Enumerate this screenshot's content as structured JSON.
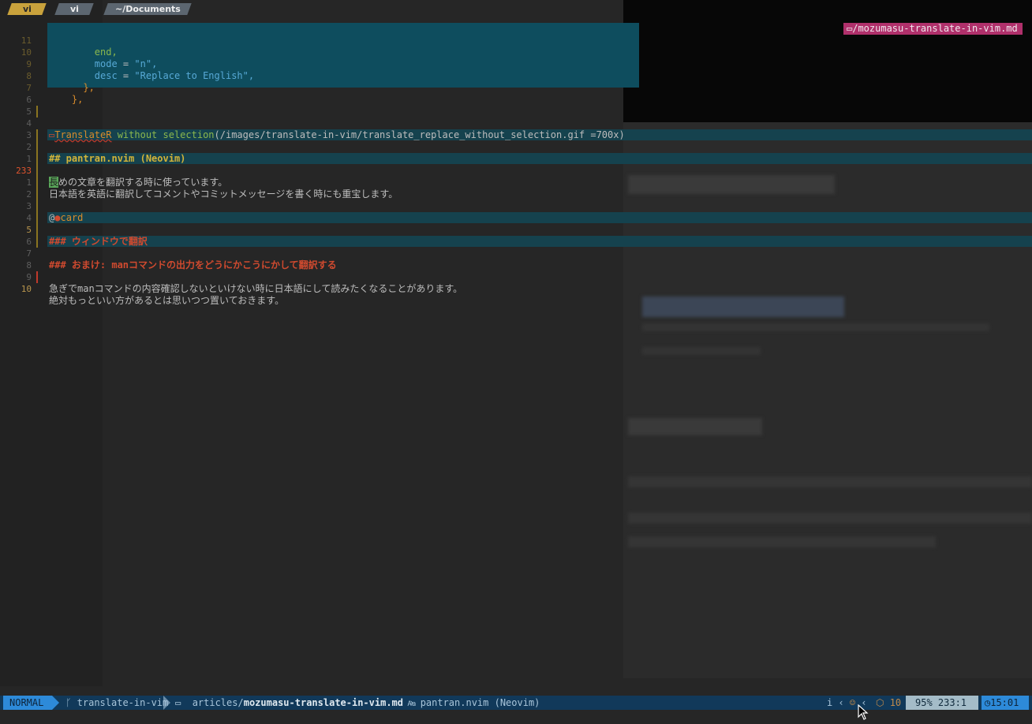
{
  "tabs": [
    {
      "label": "vi"
    },
    {
      "label": "vi"
    },
    {
      "label": "~/Documents"
    }
  ],
  "file_tag": "/mozumasu-translate-in-vim.md",
  "popup_lines": [
    {
      "num": "11",
      "text": "        end,"
    },
    {
      "num": "10",
      "key": "        mode",
      "eq": " = ",
      "val": "\"n\","
    },
    {
      "num": "9",
      "key": "        desc",
      "eq": " = ",
      "val": "\"Replace to English\","
    },
    {
      "num": "8",
      "text": "      },"
    },
    {
      "num": "7",
      "text": "    },"
    }
  ],
  "editor": {
    "l6_num": "6",
    "l5_num": "5",
    "l4_num": "4",
    "l4_link_text": "TranslateR",
    "l4_rest": " without selection",
    "l4_path": "(/images/translate-in-vim/translate_replace_without_selection.gif =700x)",
    "l3_num": "3",
    "l2_num": "2",
    "l2_heading": "## pantran.nvim (Neovim)",
    "l1_num": "1",
    "l233_num": "233",
    "l233_cursor_char": "長",
    "l233_rest": "めの文章を翻訳する時に使っています。",
    "r1_num": "1",
    "r1_text": "日本語を英語に翻訳してコメントやコミットメッセージを書く時にも重宝します。",
    "r2_num": "2",
    "r3_num": "3",
    "r3_at": "@",
    "r3_card": "card",
    "r4_num": "4",
    "r5_num": "5",
    "r5_heading": "### ウィンドウで翻訳",
    "r6_num": "6",
    "r7_num": "7",
    "r7_heading": "### おまけ: manコマンドの出力をどうにかこうにかして翻訳する",
    "r8_num": "8",
    "r9_num": "9",
    "r9_text": "急ぎでmanコマンドの内容確認しないといけない時に日本語にして読みたくなることがあります。",
    "r10_num": "10",
    "r10_text": "絶対もっといい方があるとは思いつつ置いておきます。"
  },
  "statusline": {
    "mode": "NORMAL",
    "branch": "translate-in-vim",
    "path_dir": "articles/",
    "path_file": "mozumasu-translate-in-vim.md",
    "crumb": "pantran.nvim (Neovim)",
    "lsp_label": "i",
    "diag_count": "10",
    "position": "95% 233:1",
    "time": "15:01"
  },
  "colors": {
    "accent": "#2d8ad9",
    "popup_bg": "#0e4d5e",
    "heading_yellow": "#d2b43a",
    "heading_red": "#d04a2f",
    "file_tag_bg": "#b0306b"
  }
}
